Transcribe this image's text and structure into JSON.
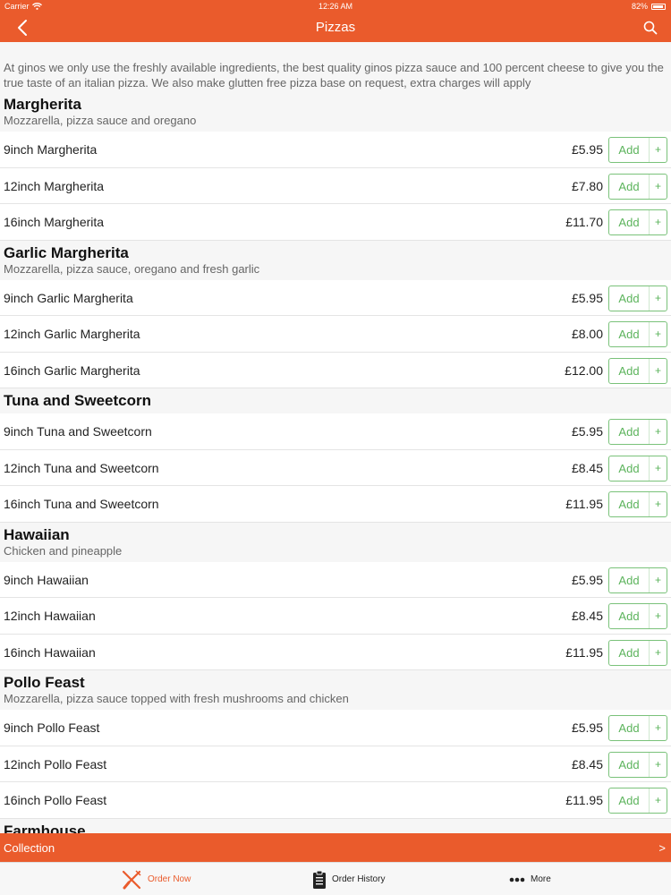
{
  "statusbar": {
    "carrier": "Carrier",
    "time": "12:26 AM",
    "battery": "82%"
  },
  "nav": {
    "title": "Pizzas"
  },
  "intro": "At ginos we only use the freshly available ingredients, the best quality ginos pizza sauce and 100 percent cheese to give you the true taste of an italian pizza. We also make glutten free pizza base on request, extra charges will apply",
  "add_label": "Add",
  "add_plus": "+",
  "sections": [
    {
      "title": "Margherita",
      "desc": "Mozzarella, pizza sauce and oregano",
      "items": [
        {
          "name": "9inch Margherita",
          "price": "£5.95"
        },
        {
          "name": "12inch Margherita",
          "price": "£7.80"
        },
        {
          "name": "16inch Margherita",
          "price": "£11.70"
        }
      ]
    },
    {
      "title": "Garlic Margherita",
      "desc": "Mozzarella, pizza sauce, oregano and fresh garlic",
      "items": [
        {
          "name": "9inch Garlic Margherita",
          "price": "£5.95"
        },
        {
          "name": "12inch Garlic Margherita",
          "price": "£8.00"
        },
        {
          "name": "16inch Garlic Margherita",
          "price": "£12.00"
        }
      ]
    },
    {
      "title": "Tuna and Sweetcorn",
      "desc": "",
      "items": [
        {
          "name": "9inch Tuna and Sweetcorn",
          "price": "£5.95"
        },
        {
          "name": "12inch Tuna and Sweetcorn",
          "price": "£8.45"
        },
        {
          "name": "16inch Tuna and Sweetcorn",
          "price": "£11.95"
        }
      ]
    },
    {
      "title": "Hawaiian",
      "desc": "Chicken and pineapple",
      "items": [
        {
          "name": "9inch Hawaiian",
          "price": "£5.95"
        },
        {
          "name": "12inch Hawaiian",
          "price": "£8.45"
        },
        {
          "name": "16inch Hawaiian",
          "price": "£11.95"
        }
      ]
    },
    {
      "title": "Pollo Feast",
      "desc": "Mozzarella, pizza sauce topped with fresh mushrooms and chicken",
      "items": [
        {
          "name": "9inch Pollo Feast",
          "price": "£5.95"
        },
        {
          "name": "12inch Pollo Feast",
          "price": "£8.45"
        },
        {
          "name": "16inch Pollo Feast",
          "price": "£11.95"
        }
      ]
    },
    {
      "title": "Farmhouse",
      "desc": "",
      "items": []
    }
  ],
  "collection": {
    "label": "Collection",
    "chevron": ">"
  },
  "tabs": {
    "order_now": "Order Now",
    "order_history": "Order History",
    "more": "More"
  },
  "colors": {
    "brand": "#ea5b2c",
    "add_green": "#5bb35b"
  },
  "icons": {
    "back": "chevron-left-icon",
    "search": "search-icon",
    "order_now": "fork-knife-icon",
    "order_history": "clipboard-icon",
    "more": "dots-icon"
  }
}
